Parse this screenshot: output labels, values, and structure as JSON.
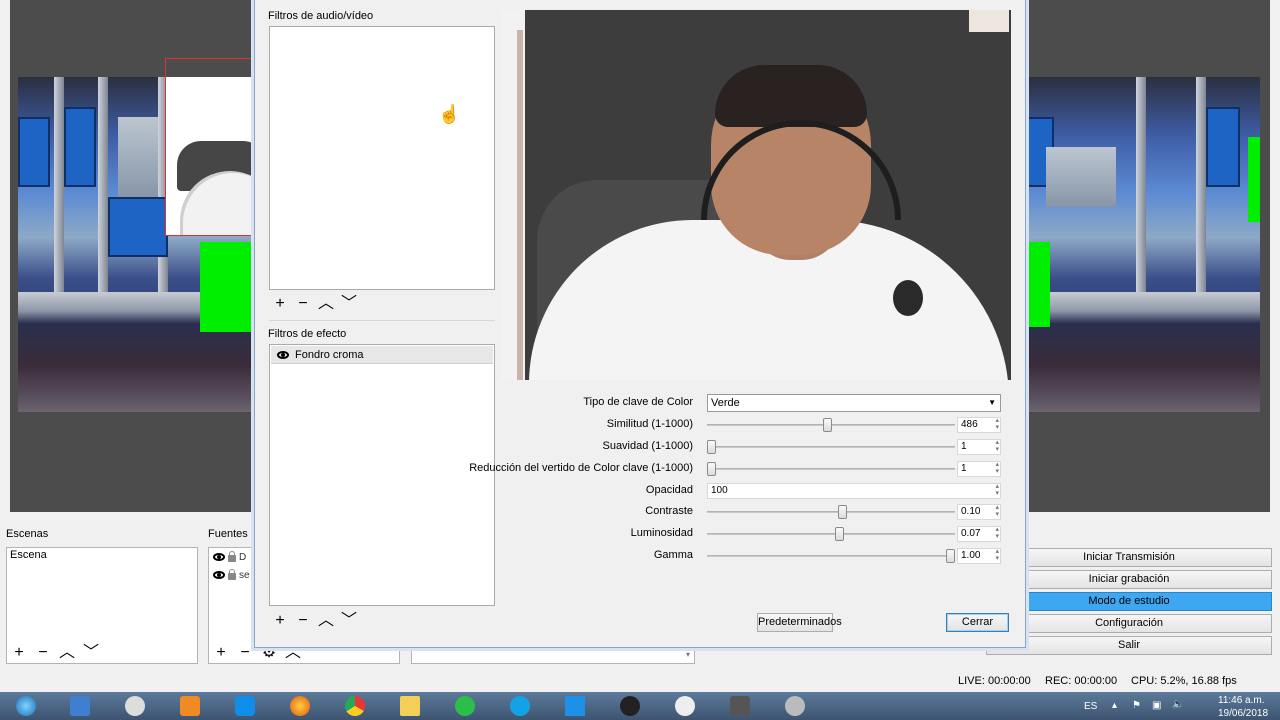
{
  "main": {
    "docks": {
      "scenes_title": "Escenas",
      "sources_title": "Fuentes",
      "scenes": [
        "Escena"
      ],
      "sources": [
        "D",
        "se"
      ]
    },
    "controls": [
      {
        "label": "Iniciar Transmisión",
        "active": false
      },
      {
        "label": "Iniciar grabación",
        "active": false
      },
      {
        "label": "Modo de estudio",
        "active": true
      },
      {
        "label": "Configuración",
        "active": false
      },
      {
        "label": "Salir",
        "active": false
      }
    ],
    "status": {
      "live": "LIVE: 00:00:00",
      "rec": "REC: 00:00:00",
      "cpu": "CPU: 5.2%, 16.88 fps"
    }
  },
  "dialog": {
    "av_filters_label": "Filtros de audio/vídeo",
    "effect_filters_label": "Filtros de efecto",
    "effect_items": [
      "Fondro croma"
    ],
    "properties": {
      "key_color_type_label": "Tipo de clave de Color",
      "key_color_type_value": "Verde",
      "similarity_label": "Similitud (1-1000)",
      "similarity_value": "486",
      "smoothness_label": "Suavidad (1-1000)",
      "smoothness_value": "1",
      "spill_label": "Reducción del vertido de Color clave (1-1000)",
      "spill_value": "1",
      "opacity_label": "Opacidad",
      "opacity_value": "100",
      "contrast_label": "Contraste",
      "contrast_value": "0.10",
      "brightness_label": "Luminosidad",
      "brightness_value": "0.07",
      "gamma_label": "Gamma",
      "gamma_value": "1.00"
    },
    "sliders": {
      "similarity": 0.486,
      "smoothness": 0.0,
      "spill": 0.0,
      "contrast": 0.55,
      "brightness": 0.535,
      "gamma": 1.0
    },
    "defaults_button": "Predeterminados",
    "close_button": "Cerrar"
  },
  "taskbar": {
    "lang": "ES",
    "time": "11:46 a.m.",
    "date": "19/06/2018",
    "apps": [
      "start-orb-icon",
      "snipping-tool-icon",
      "app-icon",
      "sublime-icon",
      "teamviewer-icon",
      "firefox-icon",
      "chrome-icon",
      "file-explorer-icon",
      "whatsapp-icon",
      "skype-icon",
      "windows-store-icon",
      "obs-icon",
      "vectr-icon",
      "media-icon",
      "webcam-icon"
    ]
  }
}
